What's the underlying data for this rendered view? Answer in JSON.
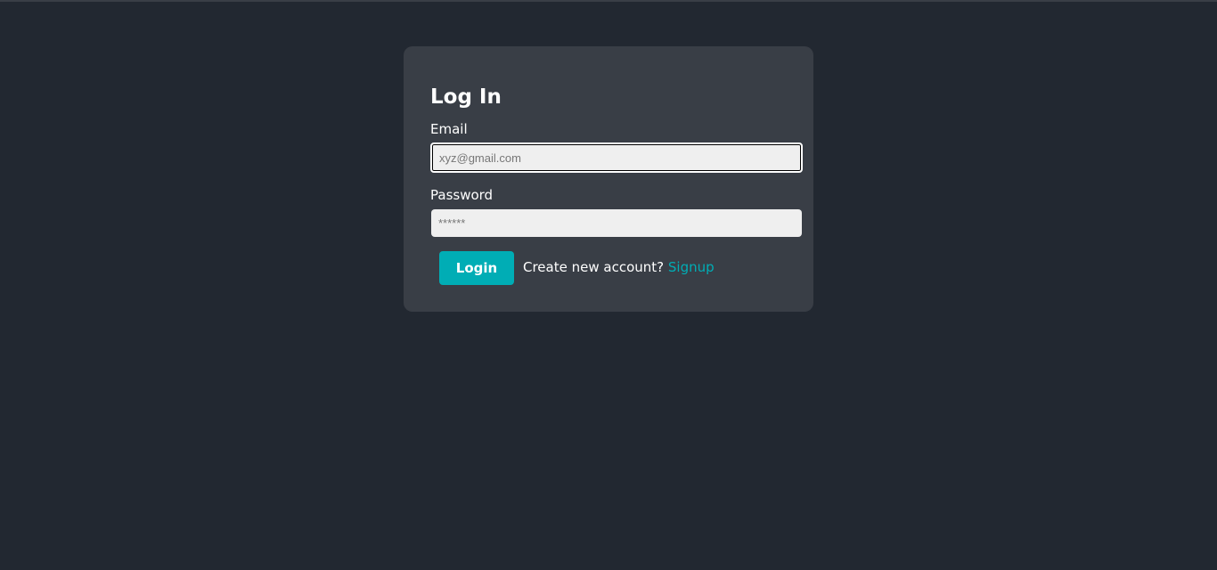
{
  "login_form": {
    "title": "Log In",
    "email": {
      "label": "Email",
      "placeholder": "xyz@gmail.com",
      "value": ""
    },
    "password": {
      "label": "Password",
      "placeholder": "******",
      "value": ""
    },
    "submit_label": "Login",
    "signup_prompt": "Create new account?",
    "signup_link": "Signup"
  },
  "colors": {
    "background": "#222831",
    "card": "#393e46",
    "accent": "#00adb5",
    "input_background": "#efefef",
    "text": "#ffffff"
  }
}
